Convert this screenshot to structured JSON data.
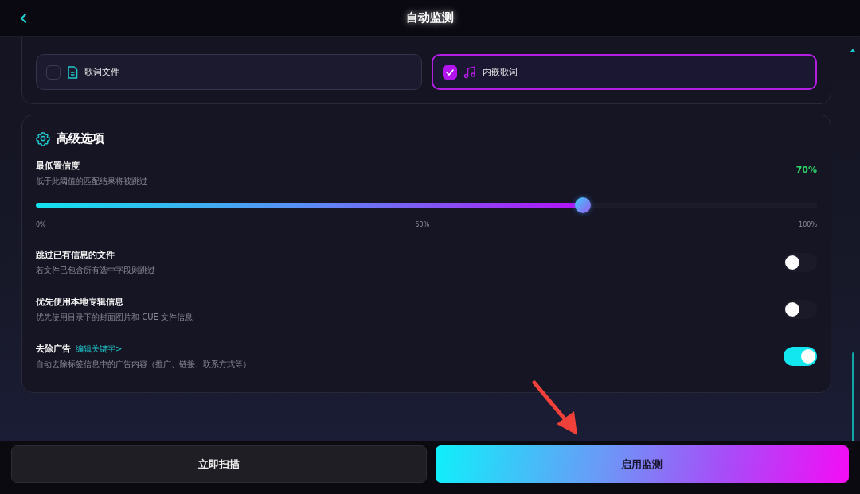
{
  "header": {
    "title": "自动监测"
  },
  "lyrics_options": [
    {
      "label": "歌词文件",
      "kind": "file",
      "checked": false
    },
    {
      "label": "内嵌歌词",
      "kind": "music",
      "checked": true
    }
  ],
  "advanced": {
    "title": "高级选项",
    "confidence": {
      "label": "最低置信度",
      "description": "低于此阈值的匹配结果将被跳过",
      "reading": "70%",
      "level": 0.7,
      "ticks": [
        "0%",
        "50%",
        "100%"
      ]
    },
    "toggles": [
      {
        "label": "跳过已有信息的文件",
        "description": "若文件已包含所有选中字段则跳过",
        "on": false
      },
      {
        "label": "优先使用本地专辑信息",
        "description": "优先使用目录下的封面图片和 CUE 文件信息",
        "on": false
      },
      {
        "label": "去除广告",
        "link": "编辑关键字>",
        "description": "自动去除标签信息中的广告内容（推广、链接、联系方式等）",
        "on": true
      }
    ]
  },
  "buttons": [
    {
      "label": "立即扫描",
      "kind": "secondary"
    },
    {
      "label": "启用监测",
      "kind": "primary"
    }
  ]
}
